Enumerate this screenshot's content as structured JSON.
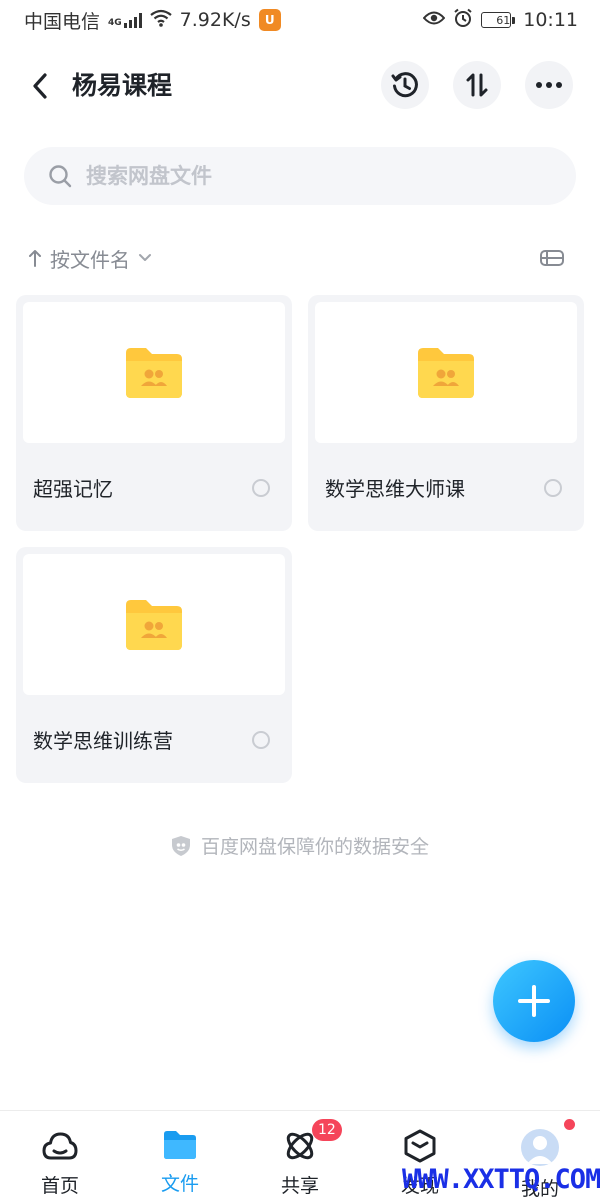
{
  "status_bar": {
    "carrier": "中国电信",
    "network": "4G",
    "speed": "7.92K/s",
    "battery": "61",
    "time": "10:11",
    "icons": [
      "signal-icon",
      "wifi-icon",
      "uc-browser-icon",
      "eye-icon",
      "alarm-icon",
      "battery-icon"
    ]
  },
  "header": {
    "title": "杨易课程",
    "icons": [
      "back-icon",
      "history-icon",
      "sort-transfer-icon",
      "more-icon"
    ]
  },
  "search": {
    "placeholder": "搜索网盘文件"
  },
  "sort": {
    "label": "按文件名",
    "icons": [
      "arrow-up-icon",
      "chevron-down-icon",
      "list-view-icon"
    ]
  },
  "folders": [
    {
      "name": "超强记忆"
    },
    {
      "name": "数学思维大师课"
    },
    {
      "name": "数学思维训练营"
    }
  ],
  "footer_note": "百度网盘保障你的数据安全",
  "nav": {
    "items": [
      {
        "label": "首页",
        "icon": "cloud-home-icon"
      },
      {
        "label": "文件",
        "icon": "folder-icon"
      },
      {
        "label": "共享",
        "icon": "share-atom-icon",
        "badge": "12"
      },
      {
        "label": "发现",
        "icon": "discover-cube-icon"
      },
      {
        "label": "我的",
        "icon": "avatar-icon"
      }
    ]
  },
  "colors": {
    "accent": "#1a9cf0",
    "folder": "#ffd43b",
    "badge": "#f5455a"
  },
  "watermark": "WWW.XXTTQ.COM"
}
